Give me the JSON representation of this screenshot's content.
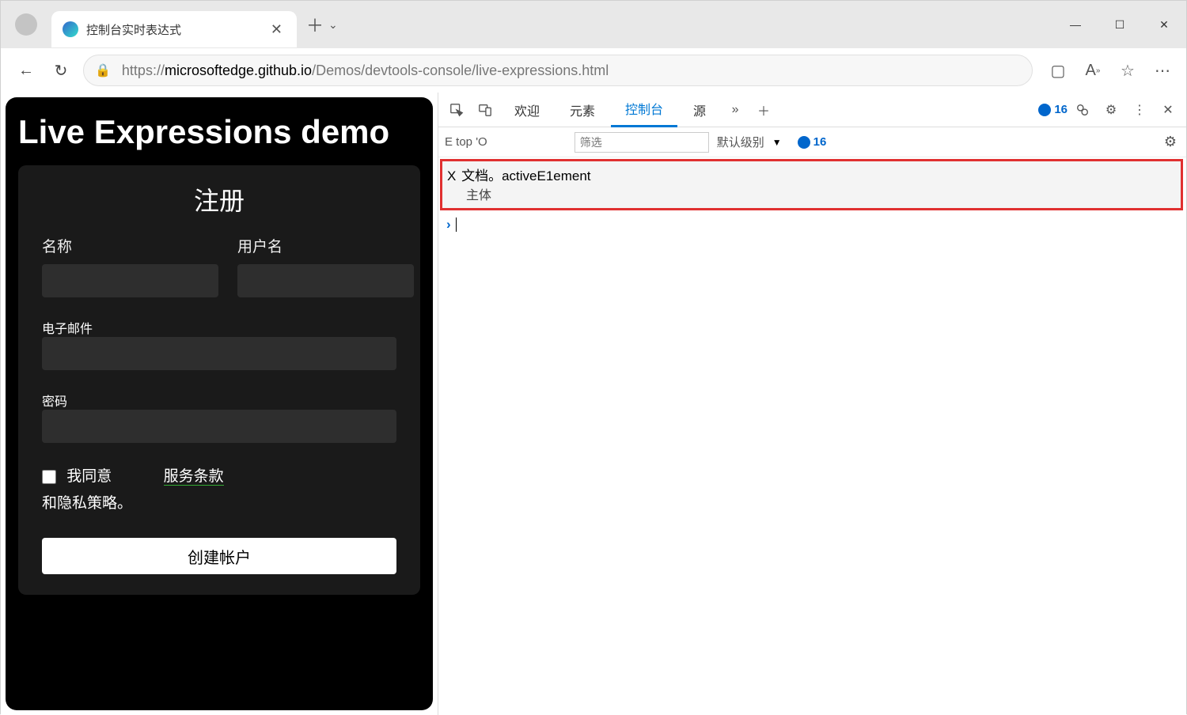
{
  "browser": {
    "tab_title": "控制台实时表达式",
    "url_protocol": "https://",
    "url_host": "microsoftedge.github.io",
    "url_path": "/Demos/devtools-console/live-expressions.html"
  },
  "page": {
    "heading": "Live Expressions demo",
    "form": {
      "title": "注册",
      "name_label": "名称",
      "username_label": "用户名",
      "email_label": "电子邮件",
      "password_label": "密码",
      "consent_prefix": "我同意",
      "consent_suffix": "和隐私策略。",
      "tos_link": "服务条款",
      "submit_label": "创建帐户"
    }
  },
  "devtools": {
    "tabs": {
      "welcome": "欢迎",
      "elements": "元素",
      "console": "控制台",
      "sources": "源"
    },
    "issue_count": "16",
    "filter": {
      "context": "E top 'O",
      "filter_placeholder": "筛选",
      "level_label": "默认级别",
      "count": "16"
    },
    "live_expression": {
      "close": "X",
      "expression": "文档。activeE1ement",
      "result": "主体"
    }
  }
}
